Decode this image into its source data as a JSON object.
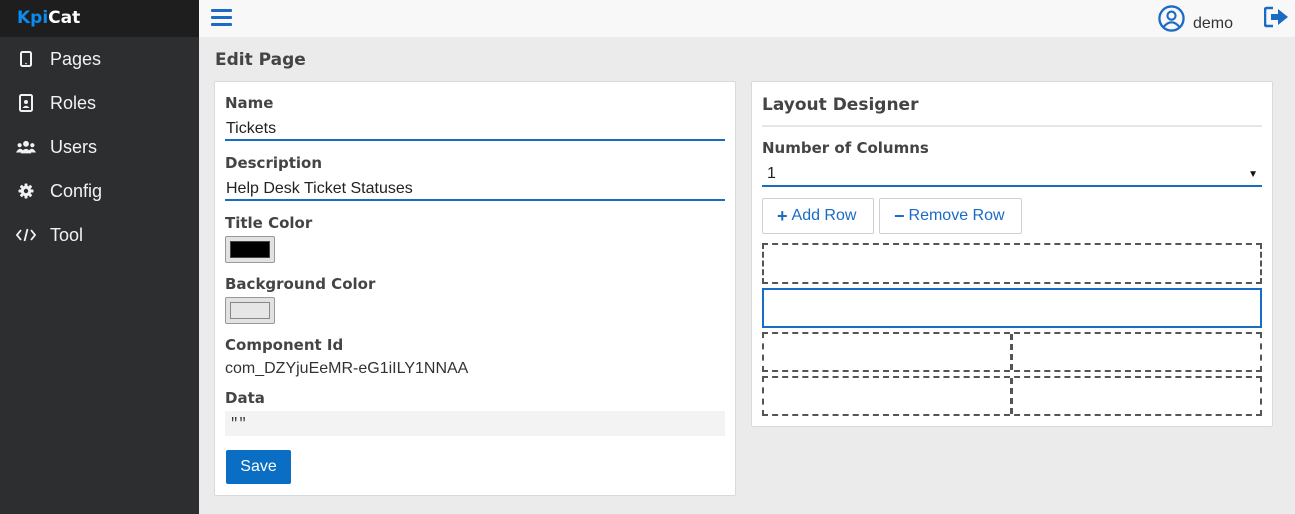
{
  "app": {
    "brand_prefix": "Kpi",
    "brand_suffix": "Cat"
  },
  "sidebar": {
    "items": [
      {
        "label": "Pages",
        "icon": "tablet-icon"
      },
      {
        "label": "Roles",
        "icon": "id-badge-icon"
      },
      {
        "label": "Users",
        "icon": "users-icon"
      },
      {
        "label": "Config",
        "icon": "gear-icon"
      },
      {
        "label": "Tool",
        "icon": "code-icon"
      }
    ]
  },
  "header": {
    "user_name": "demo",
    "menu_icon": "hamburger-icon",
    "user_icon": "user-circle-icon",
    "logout_icon": "sign-out-icon"
  },
  "page": {
    "title": "Edit Page"
  },
  "form": {
    "name_label": "Name",
    "name_value": "Tickets",
    "description_label": "Description",
    "description_value": "Help Desk Ticket Statuses",
    "title_color_label": "Title Color",
    "title_color": "#000000",
    "background_color_label": "Background Color",
    "background_color": "#e6e6e6",
    "component_id_label": "Component Id",
    "component_id_value": "com_DZYjuEeMR-eG1iILY1NNAA",
    "data_label": "Data",
    "data_value": "\"\"",
    "save_label": "Save"
  },
  "layout_designer": {
    "title": "Layout Designer",
    "columns_label": "Number of Columns",
    "columns_value": "1",
    "add_row_label": "Add Row",
    "remove_row_label": "Remove Row",
    "rows": [
      {
        "columns": 1,
        "selected": false
      },
      {
        "columns": 1,
        "selected": true
      },
      {
        "columns": 2,
        "selected": false
      },
      {
        "columns": 2,
        "selected": false
      }
    ]
  },
  "colors": {
    "accent": "#1a6bc4",
    "primary_button": "#0b6ec5",
    "sidebar_bg": "#2c2e2f",
    "brand_accent": "#0a8cf0"
  }
}
